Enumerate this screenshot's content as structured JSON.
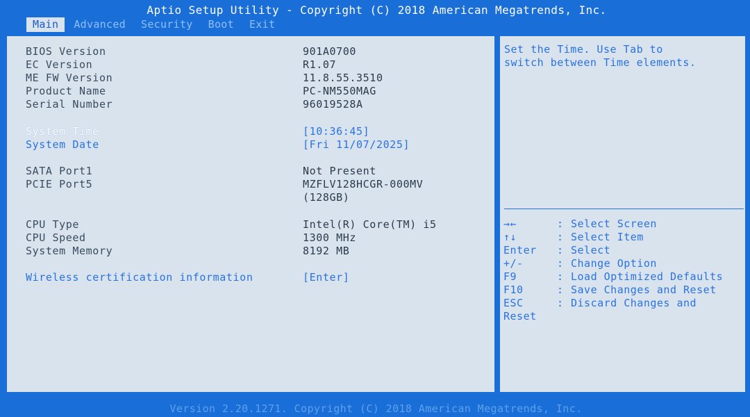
{
  "title": "Aptio Setup Utility - Copyright (C) 2018 American Megatrends, Inc.",
  "tabs": [
    {
      "label": "Main",
      "active": true
    },
    {
      "label": "Advanced",
      "active": false
    },
    {
      "label": "Security",
      "active": false
    },
    {
      "label": "Boot",
      "active": false
    },
    {
      "label": "Exit",
      "active": false
    }
  ],
  "info": {
    "bios_version": {
      "label": "BIOS Version",
      "value": "901A0700"
    },
    "ec_version": {
      "label": "EC Version",
      "value": "R1.07"
    },
    "me_fw_version": {
      "label": "ME FW Version",
      "value": "11.8.55.3510"
    },
    "product_name": {
      "label": "Product Name",
      "value": "PC-NM550MAG"
    },
    "serial_number": {
      "label": "Serial Number",
      "value": "96019528A"
    },
    "system_time": {
      "label": "System Time",
      "value": "[10:36:45]"
    },
    "system_date": {
      "label": "System Date",
      "value": "[Fri 11/07/2025]"
    },
    "sata_port1": {
      "label": "SATA Port1",
      "value": "Not Present"
    },
    "pcie_port5": {
      "label": "PCIE Port5",
      "value": "MZFLV128HCGR-000MV",
      "value2": "(128GB)"
    },
    "cpu_type": {
      "label": "CPU Type",
      "value": "Intel(R) Core(TM) i5"
    },
    "cpu_speed": {
      "label": "CPU Speed",
      "value": "1300 MHz"
    },
    "system_memory": {
      "label": "System Memory",
      "value": "8192 MB"
    },
    "wireless_cert": {
      "label": "Wireless certification information",
      "value": "[Enter]"
    }
  },
  "help": {
    "line1": "Set the Time. Use Tab to",
    "line2": "switch between Time elements."
  },
  "keys": [
    {
      "key": "→←",
      "sep": ":",
      "desc": "Select Screen"
    },
    {
      "key": "↑↓",
      "sep": ":",
      "desc": "Select Item"
    },
    {
      "key": "Enter",
      "sep": ":",
      "desc": "Select"
    },
    {
      "key": "+/-",
      "sep": ":",
      "desc": "Change Option"
    },
    {
      "key": "F9",
      "sep": ":",
      "desc": "Load Optimized Defaults"
    },
    {
      "key": "F10",
      "sep": ":",
      "desc": "Save Changes and Reset"
    },
    {
      "key": "ESC",
      "sep": ":",
      "desc": "Discard Changes and"
    },
    {
      "key": "Reset",
      "sep": "",
      "desc": ""
    }
  ],
  "footer": "Version 2.20.1271. Copyright (C) 2018 American Megatrends, Inc.",
  "colors": {
    "frame_blue": "#1a6ed8",
    "panel_bg": "#d8e3ee",
    "link_blue": "#2a72e0",
    "text_gray": "#3a4b5e",
    "selected_white": "#ffffff"
  }
}
